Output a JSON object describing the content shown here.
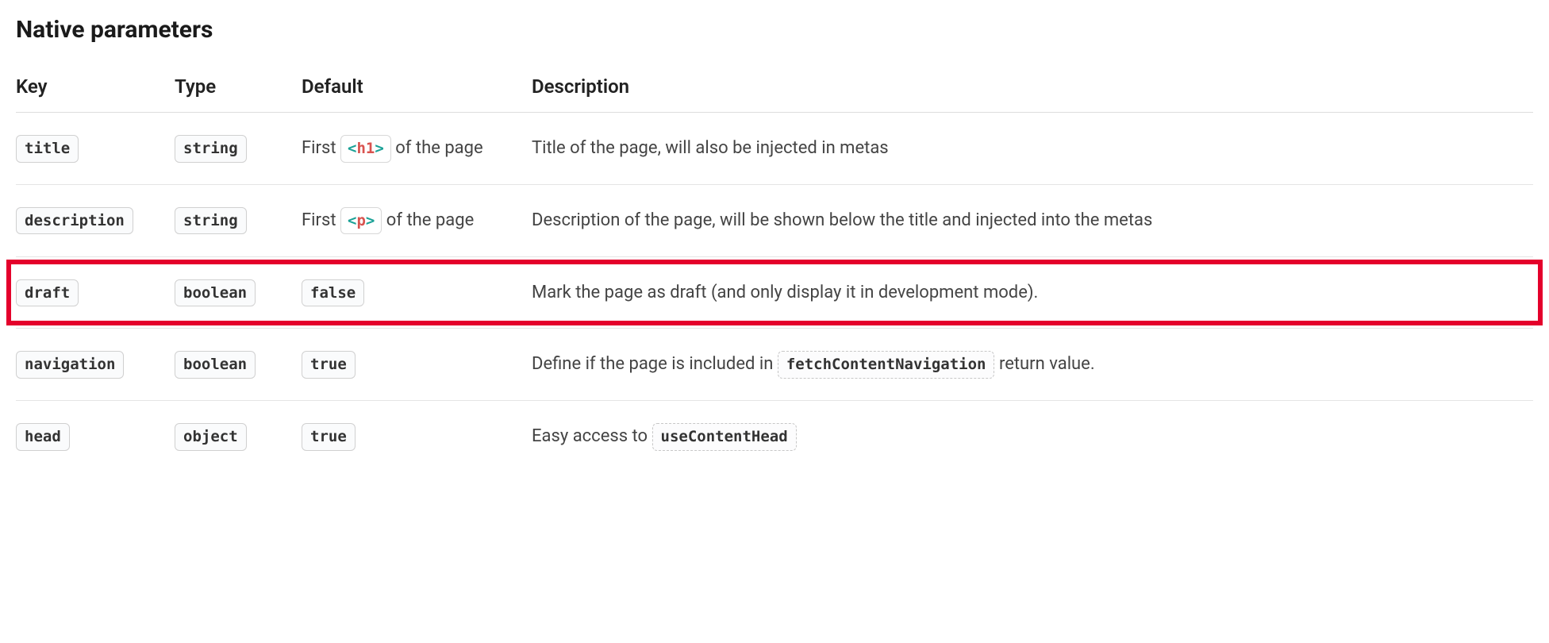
{
  "heading": "Native parameters",
  "columns": {
    "key": "Key",
    "type": "Type",
    "default": "Default",
    "description": "Description"
  },
  "rows": [
    {
      "key": "title",
      "type": "string",
      "default_prefix": "First ",
      "default_tag": "h1",
      "default_suffix": " of the page",
      "description": "Title of the page, will also be injected in metas"
    },
    {
      "key": "description",
      "type": "string",
      "default_prefix": "First ",
      "default_tag": "p",
      "default_suffix": " of the page",
      "description": "Description of the page, will be shown below the title and injected into the metas"
    },
    {
      "key": "draft",
      "type": "boolean",
      "default_value": "false",
      "description": "Mark the page as draft (and only display it in development mode).",
      "highlight": true
    },
    {
      "key": "navigation",
      "type": "boolean",
      "default_value": "true",
      "desc_prefix": "Define if the page is included in ",
      "desc_code": "fetchContentNavigation",
      "desc_suffix": " return value."
    },
    {
      "key": "head",
      "type": "object",
      "default_value": "true",
      "desc_prefix": "Easy access to ",
      "desc_code": "useContentHead",
      "desc_suffix": ""
    }
  ]
}
